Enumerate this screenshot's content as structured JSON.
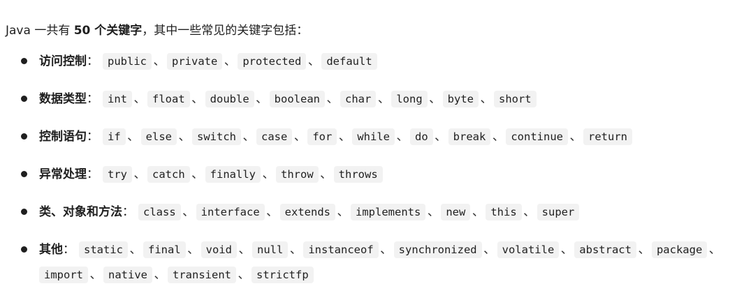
{
  "intro": {
    "prefix": "Java 一共有 ",
    "count": "50 个关键字",
    "suffix": "，其中一些常见的关键字包括："
  },
  "categories": [
    {
      "label": "访问控制",
      "keywords": [
        "public",
        "private",
        "protected",
        "default"
      ]
    },
    {
      "label": "数据类型",
      "keywords": [
        "int",
        "float",
        "double",
        "boolean",
        "char",
        "long",
        "byte",
        "short"
      ]
    },
    {
      "label": "控制语句",
      "keywords": [
        "if",
        "else",
        "switch",
        "case",
        "for",
        "while",
        "do",
        "break",
        "continue",
        "return"
      ]
    },
    {
      "label": "异常处理",
      "keywords": [
        "try",
        "catch",
        "finally",
        "throw",
        "throws"
      ]
    },
    {
      "label": "类、对象和方法",
      "keywords": [
        "class",
        "interface",
        "extends",
        "implements",
        "new",
        "this",
        "super"
      ]
    },
    {
      "label": "其他",
      "keywords": [
        "static",
        "final",
        "void",
        "null",
        "instanceof",
        "synchronized",
        "volatile",
        "abstract",
        "package",
        "import",
        "native",
        "transient",
        "strictfp"
      ]
    }
  ],
  "colon": "：",
  "separator": "、"
}
